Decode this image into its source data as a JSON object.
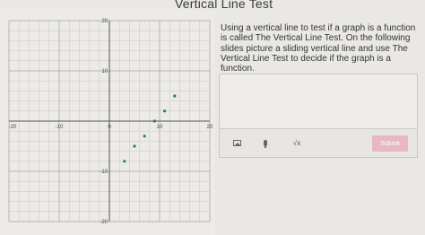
{
  "page": {
    "title": "Vertical Line Test"
  },
  "graph": {
    "x_range": [
      -20,
      20
    ],
    "y_range": [
      -20,
      20
    ],
    "major_step": 10,
    "minor_step": 2,
    "tick_labels": {
      "x": [
        "-20",
        "-10",
        "0",
        "10",
        "20"
      ],
      "y": [
        "20",
        "10",
        "-10",
        "-20"
      ]
    },
    "points": [
      {
        "x": 3,
        "y": -8
      },
      {
        "x": 5,
        "y": -5
      },
      {
        "x": 7,
        "y": -3
      },
      {
        "x": 9,
        "y": 0
      },
      {
        "x": 11,
        "y": 2
      },
      {
        "x": 13,
        "y": 5
      }
    ],
    "point_color": "#2e7d4f"
  },
  "question": {
    "text": "Using a vertical line to test if a graph is a function is called The Vertical Line Test. On the following slides picture a sliding vertical line and use The Vertical Line Test to decide if the graph is a function."
  },
  "toolbar": {
    "image_icon": "image-icon",
    "mic_icon": "microphone-icon",
    "math_label": "√x",
    "submit_label": "Submit"
  },
  "colors": {
    "submit_bg": "#e7b7c2",
    "background": "#e9e8e5"
  }
}
